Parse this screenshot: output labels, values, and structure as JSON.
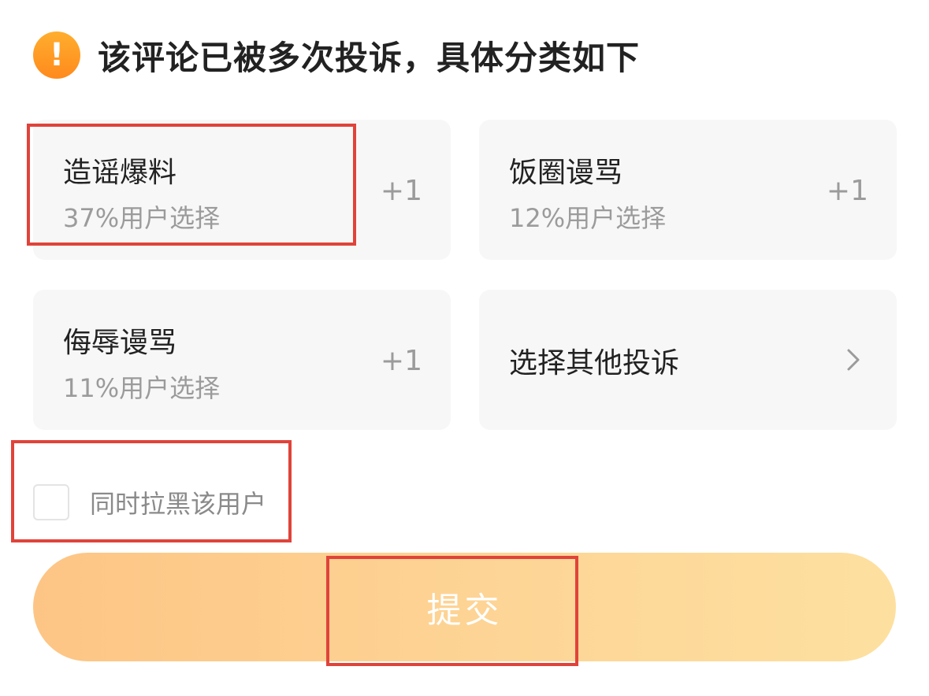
{
  "header": {
    "icon_glyph": "!",
    "icon": "warning-icon",
    "title": "该评论已被多次投诉，具体分类如下"
  },
  "options": [
    {
      "label": "造谣爆料",
      "percent_text": "37%用户选择",
      "action": "+1",
      "percent": 37
    },
    {
      "label": "饭圈谩骂",
      "percent_text": "12%用户选择",
      "action": "+1",
      "percent": 12
    },
    {
      "label": "侮辱谩骂",
      "percent_text": "11%用户选择",
      "action": "+1",
      "percent": 11
    }
  ],
  "other_option": {
    "label": "选择其他投诉",
    "icon": "chevron-right-icon"
  },
  "block_user": {
    "label": "同时拉黑该用户",
    "checked": false
  },
  "submit": {
    "label": "提交"
  },
  "colors": {
    "warning": "#ff9a22",
    "card_bg": "#f7f7f7",
    "highlight": "#e0433a",
    "submit_start": "#fdc585",
    "submit_end": "#fde0a0"
  }
}
